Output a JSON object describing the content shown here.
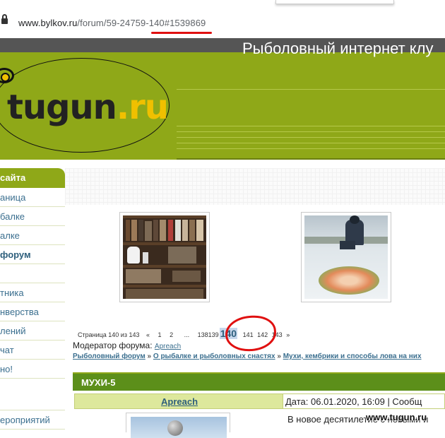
{
  "browser": {
    "url_host": "www.bylkov.ru",
    "url_path": "/forum/59-24759-140#1539869"
  },
  "header": {
    "logo_text_main": "tugun",
    "logo_text_dot": ".",
    "logo_text_ru": "ru",
    "site_title": "Рыболовный интернет клу"
  },
  "sidebar": {
    "heading": "сайта",
    "items": [
      {
        "label": "аница"
      },
      {
        "label": "балке"
      },
      {
        "label": "алке"
      },
      {
        "label": "форум"
      },
      {
        "label": ""
      },
      {
        "label": "тника"
      },
      {
        "label": "нверства"
      },
      {
        "label": "лений"
      },
      {
        "label": "чат"
      },
      {
        "label": "но!"
      },
      {
        "label": ""
      },
      {
        "label": "ероприятий"
      }
    ]
  },
  "pager": {
    "label": "Страница 140 из 143",
    "prev": "«",
    "p1": "1",
    "p2": "2",
    "dots": "...",
    "p138": "138",
    "p139": "139",
    "current": "140",
    "p141": "141",
    "p142": "142",
    "p143": "143",
    "next": "»"
  },
  "moderator": {
    "label": "Модератор форума:",
    "name": "Apreach"
  },
  "breadcrumb": {
    "item1": "Рыболовный форум",
    "sep": "»",
    "item2": "О рыбалке и рыболовных снастях",
    "item3": "Мухи, кембрики и способы лова на них"
  },
  "topic": {
    "title": "МУХИ-5"
  },
  "post": {
    "author": "Apreach",
    "date": "Дата: 06.01.2020, 16:09 | Сообщ",
    "text": "В новое десятилетие с новыми и"
  },
  "watermark": "www.tugun.ru",
  "colors": {
    "header_green": "#8fa818",
    "topic_green": "#5c8f1a",
    "link_blue": "#3b6f8f",
    "annotation_red": "#e01010"
  }
}
